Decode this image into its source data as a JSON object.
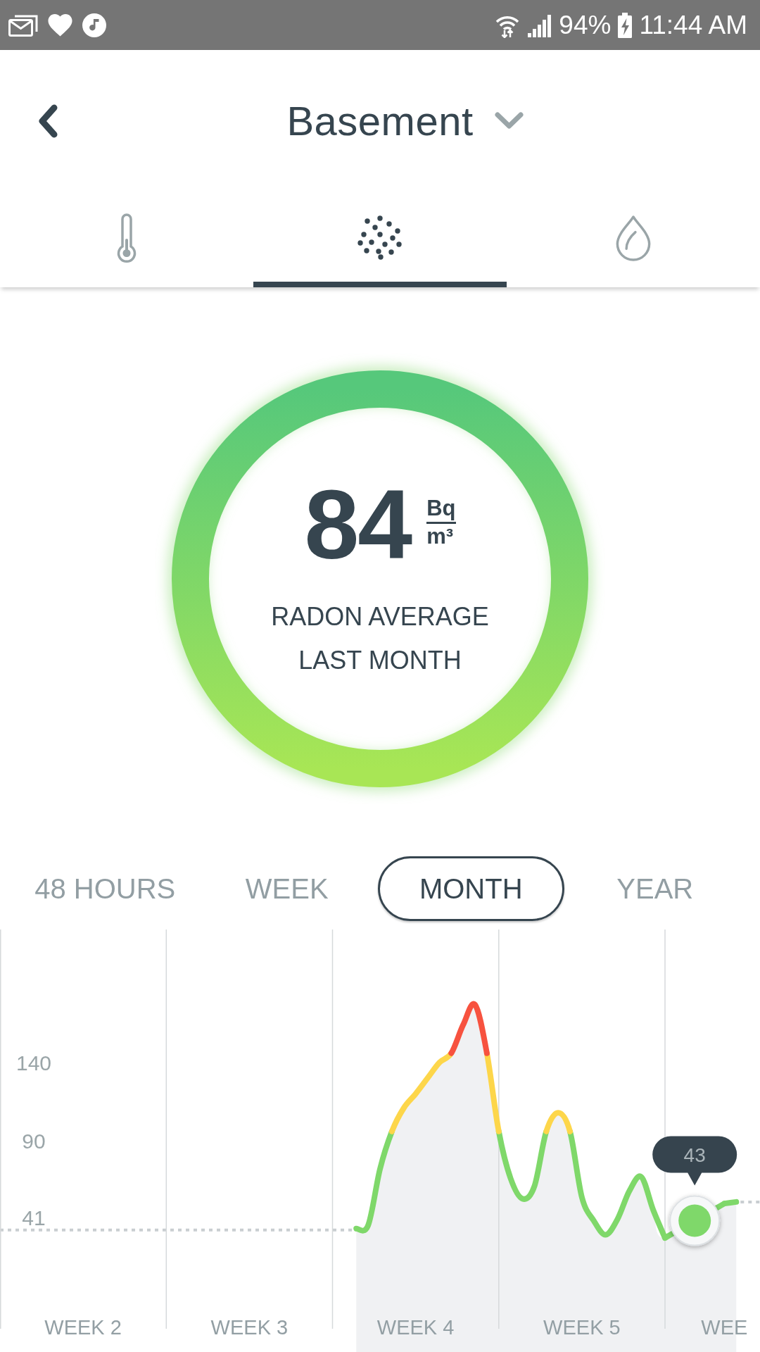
{
  "status_bar": {
    "battery": "94%",
    "time": "11:44 AM"
  },
  "header": {
    "title": "Basement"
  },
  "sensor_tabs": [
    {
      "kind": "temperature",
      "selected": false
    },
    {
      "kind": "radon",
      "selected": true
    },
    {
      "kind": "humidity",
      "selected": false
    }
  ],
  "summary": {
    "value": "84",
    "unit_numerator": "Bq",
    "unit_denominator": "m³",
    "caption": "RADON AVERAGE LAST MONTH"
  },
  "time_ranges": [
    {
      "label": "48 HOURS",
      "selected": false
    },
    {
      "label": "WEEK",
      "selected": false
    },
    {
      "label": "MONTH",
      "selected": true
    },
    {
      "label": "YEAR",
      "selected": false
    }
  ],
  "chart": {
    "chart_data": {
      "type": "line",
      "categories": [
        null,
        null,
        null,
        null,
        null,
        null,
        null,
        "WEEK 2",
        null,
        null,
        null,
        null,
        null,
        null,
        null,
        null,
        null,
        null,
        null,
        null,
        null,
        "WEEK 3",
        null,
        null,
        null,
        null,
        null,
        null,
        null,
        null,
        null,
        null,
        null,
        null,
        null,
        "WEEK 4",
        null,
        null,
        null,
        null,
        null,
        null,
        null,
        null,
        null,
        null,
        null,
        null,
        null,
        "WEEK 5",
        null,
        null,
        null,
        null,
        null,
        null,
        null,
        null,
        null,
        null,
        null,
        "WEE",
        null,
        null,
        null
      ],
      "series": [
        {
          "color": "#7fd86a",
          "values": [
            null,
            null,
            null,
            null,
            null,
            null,
            null,
            null,
            null,
            null,
            null,
            null,
            null,
            null,
            null,
            null,
            null,
            null,
            null,
            null,
            null,
            null,
            null,
            null,
            null,
            null,
            null,
            null,
            null,
            null,
            34,
            36,
            72,
            96,
            null,
            null,
            null,
            null,
            null,
            null,
            null,
            null,
            96,
            66,
            53,
            61,
            96,
            null,
            96,
            54,
            39,
            30,
            40,
            58,
            67,
            46,
            28,
            null,
            null,
            null,
            null,
            50,
            51,
            null,
            null
          ]
        },
        {
          "color": "#fdd64a",
          "values": [
            null,
            null,
            null,
            null,
            null,
            null,
            null,
            null,
            null,
            null,
            null,
            null,
            null,
            null,
            null,
            null,
            null,
            null,
            null,
            null,
            null,
            null,
            null,
            null,
            null,
            null,
            null,
            null,
            null,
            null,
            null,
            null,
            null,
            96,
            111,
            120,
            130,
            140,
            146,
            null,
            null,
            146,
            96,
            null,
            null,
            null,
            96,
            108,
            96,
            null,
            null,
            null,
            null,
            null,
            null,
            null,
            null,
            null,
            null,
            null,
            null,
            null,
            null,
            null,
            null
          ]
        },
        {
          "color": "#f7523f",
          "values": [
            null,
            null,
            null,
            null,
            null,
            null,
            null,
            null,
            null,
            null,
            null,
            null,
            null,
            null,
            null,
            null,
            null,
            null,
            null,
            null,
            null,
            null,
            null,
            null,
            null,
            null,
            null,
            null,
            null,
            null,
            null,
            null,
            null,
            null,
            null,
            null,
            null,
            null,
            146,
            164,
            177,
            146,
            null,
            null,
            null,
            null,
            null,
            null,
            null,
            null,
            null,
            null,
            null,
            null,
            null,
            null,
            null,
            null,
            null,
            null,
            null,
            null,
            null,
            null,
            null
          ]
        }
      ],
      "ylim": [
        -30,
        225
      ],
      "yticks": [
        41,
        90,
        140
      ],
      "annotations": [
        "43"
      ]
    }
  }
}
